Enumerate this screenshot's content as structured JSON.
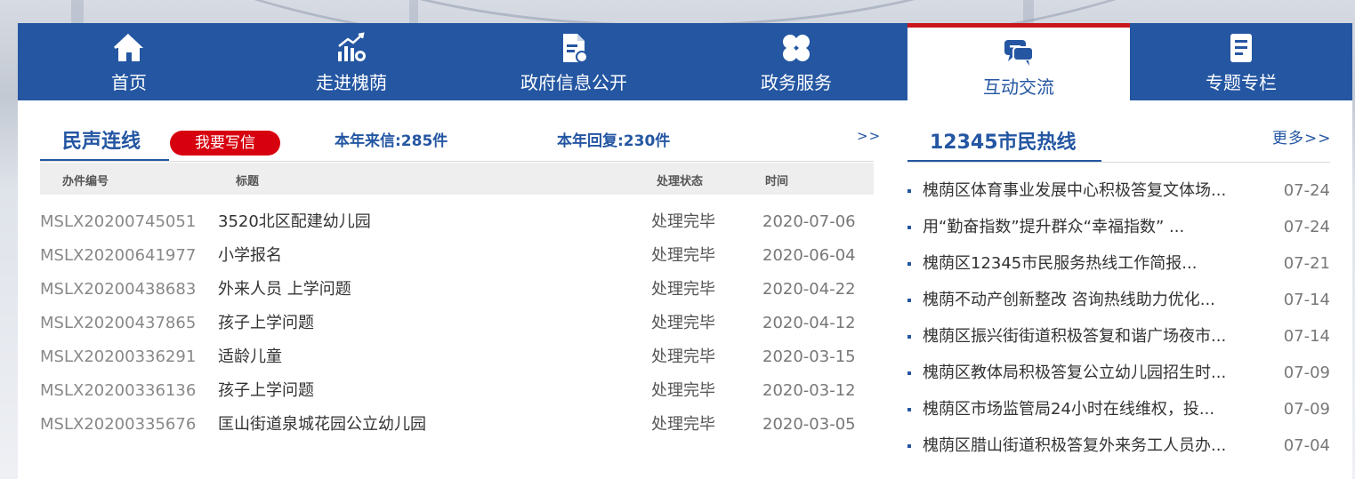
{
  "nav": [
    {
      "label": "首页",
      "icon": "home-icon"
    },
    {
      "label": "走进槐荫",
      "icon": "chart-growth-icon"
    },
    {
      "label": "政府信息公开",
      "icon": "document-icon"
    },
    {
      "label": "政务服务",
      "icon": "clover-icon"
    },
    {
      "label": "互动交流",
      "icon": "chat-icon",
      "active": true
    },
    {
      "label": "专题专栏",
      "icon": "notepad-icon"
    }
  ],
  "minsheng": {
    "title": "民声连线",
    "write_button": "我要写信",
    "letters_this_year": "本年来信:285件",
    "replies_this_year": "本年回复:230件",
    "more": ">>",
    "headers": {
      "id": "办件编号",
      "title": "标题",
      "status": "处理状态",
      "time": "时间"
    },
    "rows": [
      {
        "id": "MSLX20200745051",
        "title": "3520北区配建幼儿园",
        "status": "处理完毕",
        "date": "2020-07-06"
      },
      {
        "id": "MSLX20200641977",
        "title": "小学报名",
        "status": "处理完毕",
        "date": "2020-06-04"
      },
      {
        "id": "MSLX20200438683",
        "title": "外来人员 上学问题",
        "status": "处理完毕",
        "date": "2020-04-22"
      },
      {
        "id": "MSLX20200437865",
        "title": "孩子上学问题",
        "status": "处理完毕",
        "date": "2020-04-12"
      },
      {
        "id": "MSLX20200336291",
        "title": "适龄儿童",
        "status": "处理完毕",
        "date": "2020-03-15"
      },
      {
        "id": "MSLX20200336136",
        "title": "孩子上学问题",
        "status": "处理完毕",
        "date": "2020-03-12"
      },
      {
        "id": "MSLX20200335676",
        "title": "匡山街道泉城花园公立幼儿园",
        "status": "处理完毕",
        "date": "2020-03-05"
      }
    ]
  },
  "hotline": {
    "title": "12345市民热线",
    "more": "更多>>",
    "items": [
      {
        "title": "槐荫区体育事业发展中心积极答复文体场...",
        "date": "07-24"
      },
      {
        "title": "用“勤奋指数”提升群众“幸福指数” ...",
        "date": "07-24"
      },
      {
        "title": "槐荫区12345市民服务热线工作简报...",
        "date": "07-21"
      },
      {
        "title": "槐荫不动产创新整改 咨询热线助力优化...",
        "date": "07-14"
      },
      {
        "title": "槐荫区振兴街街道积极答复和谐广场夜市...",
        "date": "07-14"
      },
      {
        "title": "槐荫区教体局积极答复公立幼儿园招生时...",
        "date": "07-09"
      },
      {
        "title": "槐荫区市场监管局24小时在线维权，投...",
        "date": "07-09"
      },
      {
        "title": "槐荫区腊山街道积极答复外来务工人员办...",
        "date": "07-04"
      }
    ]
  },
  "colors": {
    "brand_blue": "#2456a2",
    "accent_red": "#c8161d",
    "button_red": "#d7000f"
  }
}
